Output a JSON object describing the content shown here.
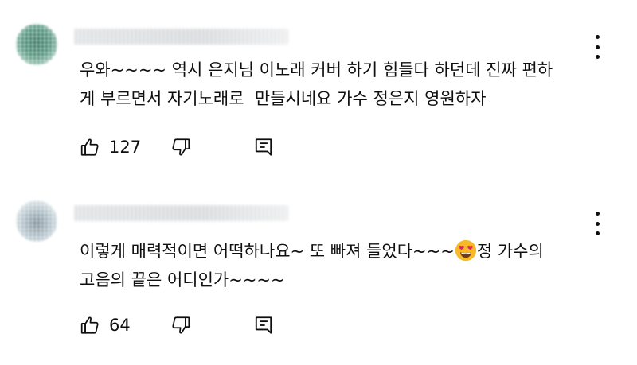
{
  "comments": [
    {
      "text": "우와~~~~ 역시 은지님 이노래 커버 하기 힘들다 하던데 진짜 편하\n게 부르면서 자기노래로  만들시네요 가수 정은지 영원하자",
      "likes": "127"
    },
    {
      "text_before_emoji": "이렇게 매력적이면 어떡하나요~ 또 빠져 들었다~~~",
      "text_after_emoji": "정 가수의\n고음의 끝은 어디인가~~~~",
      "emoji": "smiling-face-with-heart-eyes",
      "likes": "64"
    }
  ],
  "icons": {
    "like": "thumbs-up-outline-icon",
    "dislike": "thumbs-down-outline-icon",
    "reply": "reply-comment-icon",
    "menu": "more-vertical-icon"
  },
  "colors": {
    "text": "#0f0f0f",
    "background": "#ffffff",
    "emoji_face": "#f7b928",
    "emoji_hearts": "#e0245e"
  }
}
